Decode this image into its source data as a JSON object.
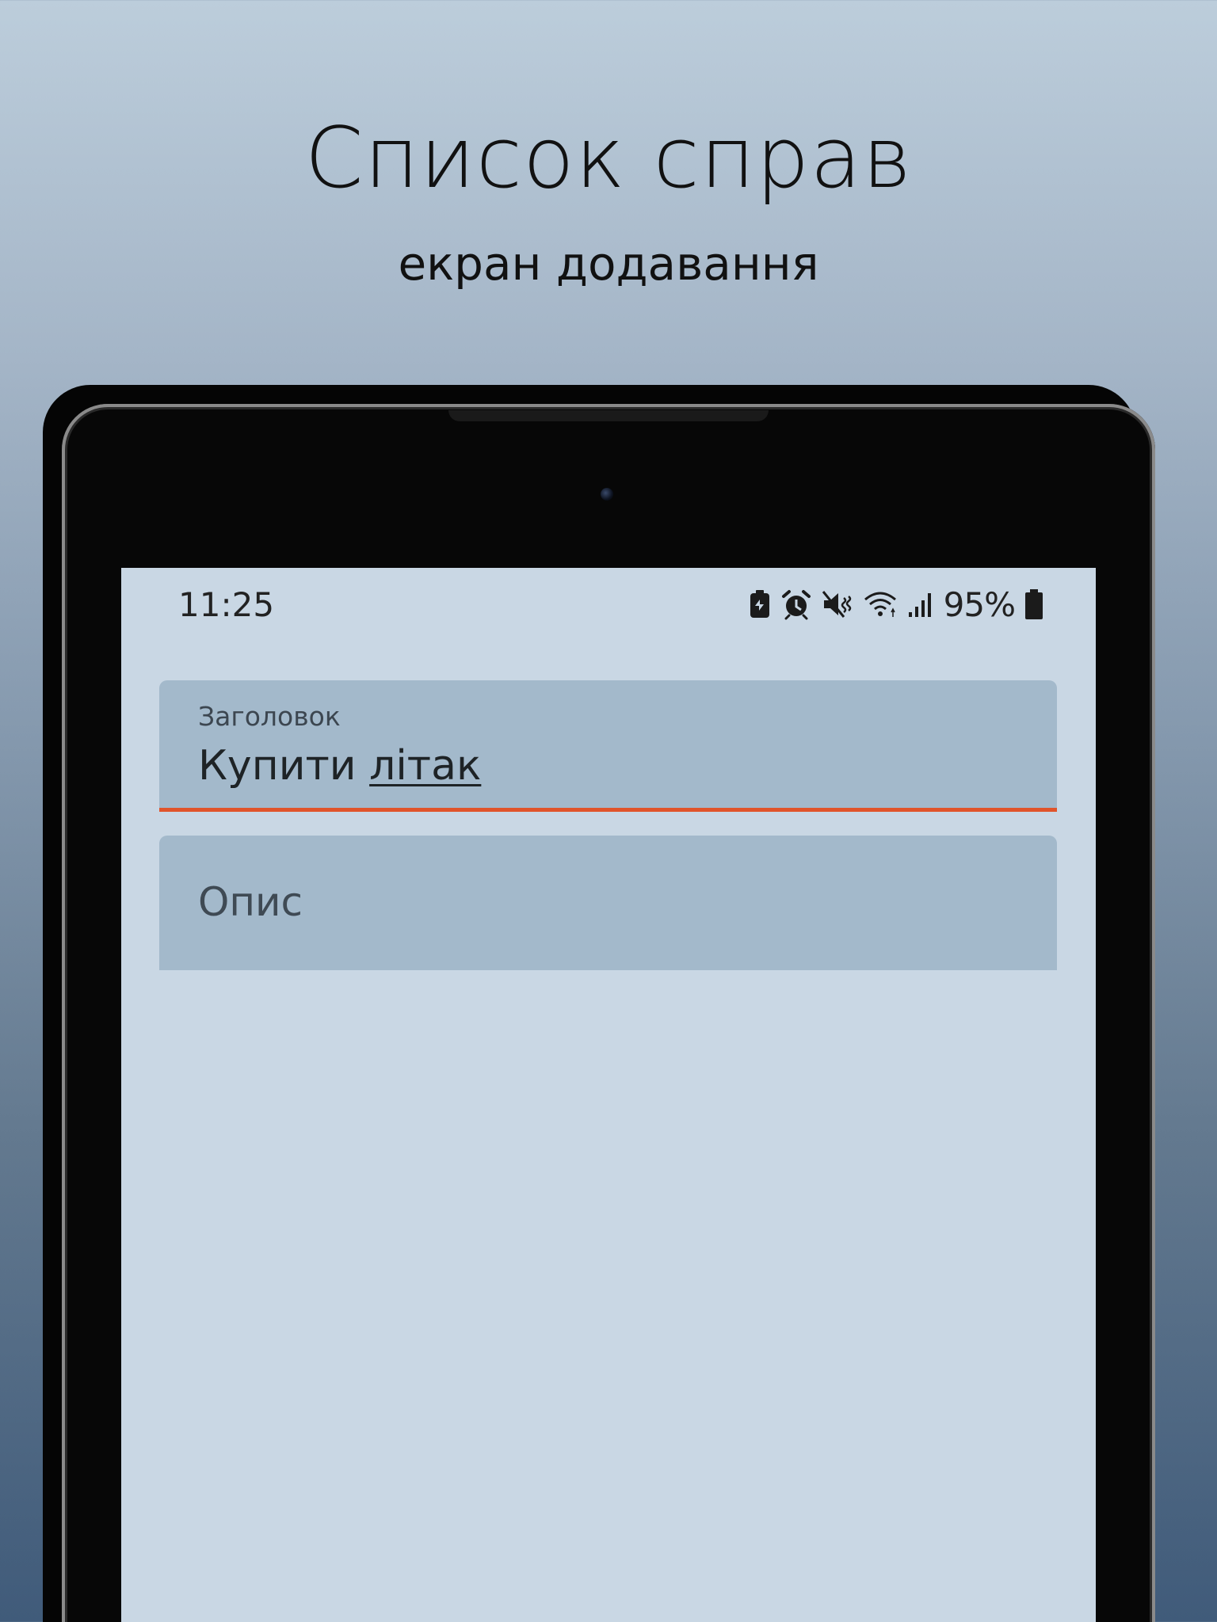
{
  "promo": {
    "title": "Список справ",
    "subtitle": "екран додавання"
  },
  "status_bar": {
    "time": "11:25",
    "battery_percent": "95%",
    "icons": [
      "battery-saver-icon",
      "alarm-icon",
      "mute-icon",
      "wifi-icon",
      "signal-icon",
      "battery-icon"
    ]
  },
  "form": {
    "title_field": {
      "label": "Заголовок",
      "value_part1": "Купити ",
      "value_part2": "літак"
    },
    "description_field": {
      "placeholder": "Опис"
    },
    "accent_color": "#e0542b",
    "field_background": "#a3b9cb",
    "screen_background": "#c9d7e4"
  }
}
